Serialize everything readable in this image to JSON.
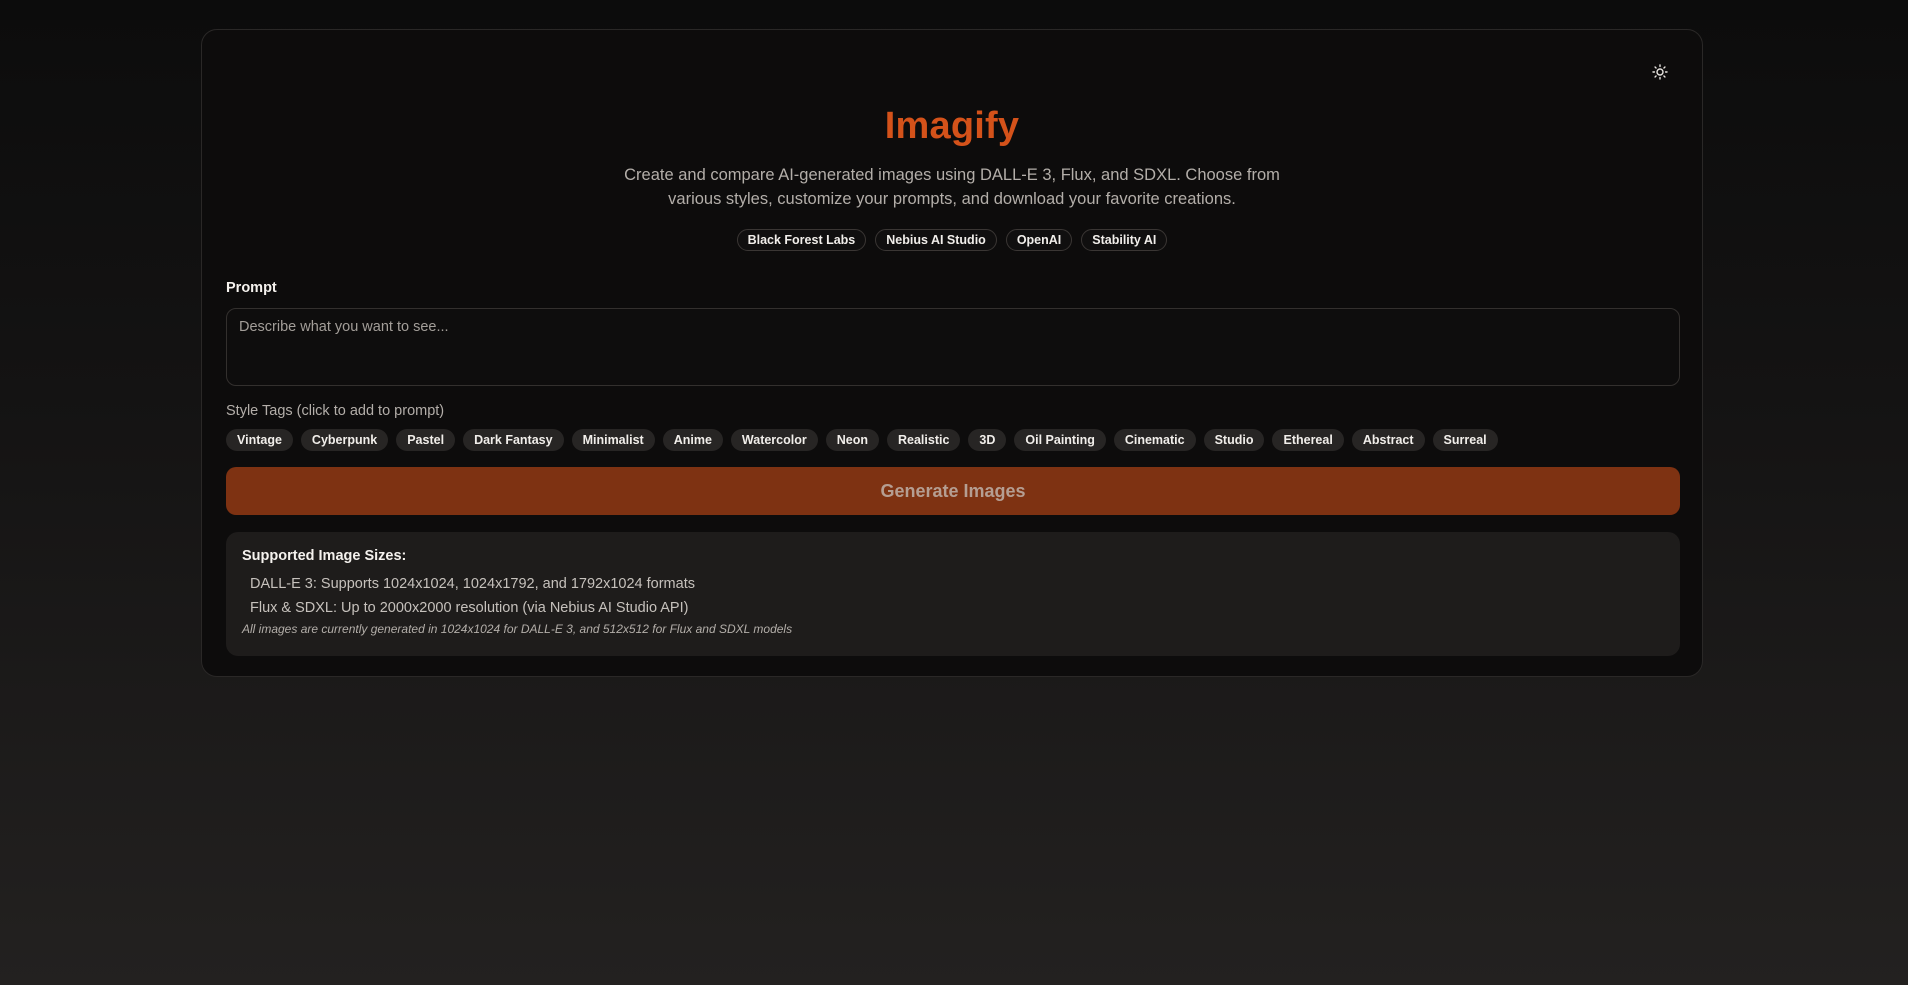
{
  "app": {
    "title": "Imagify",
    "subtitle": "Create and compare AI-generated images using DALL-E 3, Flux, and SDXL. Choose from various styles, customize your prompts, and download your favorite creations.",
    "theme_toggle_icon": "sun-icon",
    "brand_color": "#d4521a"
  },
  "providers": [
    "Black Forest Labs",
    "Nebius AI Studio",
    "OpenAI",
    "Stability AI"
  ],
  "prompt": {
    "label": "Prompt",
    "value": "",
    "placeholder": "Describe what you want to see..."
  },
  "style_tags": {
    "label": "Style Tags (click to add to prompt)",
    "items": [
      "Vintage",
      "Cyberpunk",
      "Pastel",
      "Dark Fantasy",
      "Minimalist",
      "Anime",
      "Watercolor",
      "Neon",
      "Realistic",
      "3D",
      "Oil Painting",
      "Cinematic",
      "Studio",
      "Ethereal",
      "Abstract",
      "Surreal"
    ]
  },
  "generate": {
    "label": "Generate Images",
    "color": "#7e3212"
  },
  "sizes": {
    "title": "Supported Image Sizes:",
    "items": [
      "DALL-E 3: Supports 1024x1024, 1024x1792, and 1792x1024 formats",
      "Flux & SDXL: Up to 2000x2000 resolution (via Nebius AI Studio API)"
    ],
    "note": "All images are currently generated in 1024x1024 for DALL-E 3, and 512x512 for Flux and SDXL models"
  }
}
